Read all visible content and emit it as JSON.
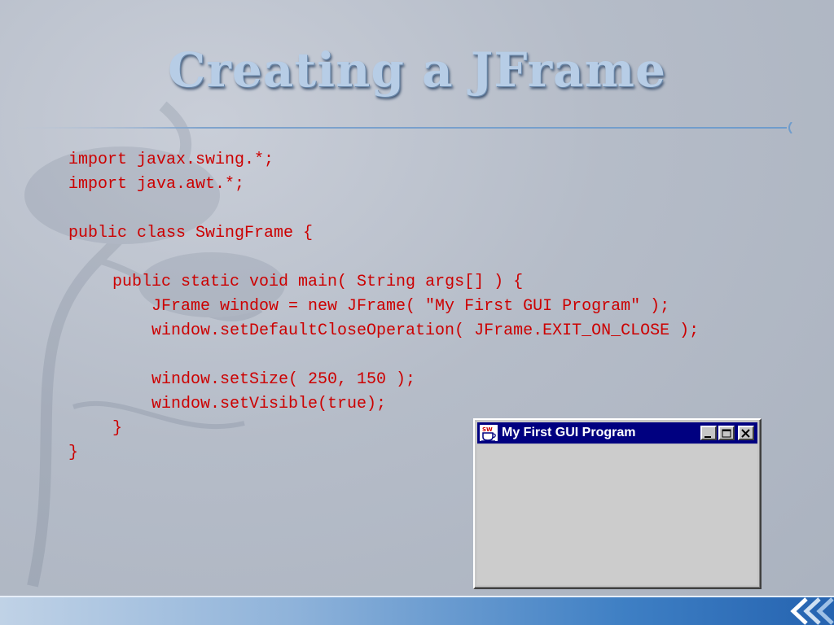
{
  "slide": {
    "title": "Creating a JFrame"
  },
  "code": {
    "lines": [
      "import javax.swing.*;",
      "import java.awt.*;",
      "",
      "public class SwingFrame {",
      "",
      "public static void main( String args[] ) {",
      "JFrame window = new JFrame( \"My First GUI Program\" );",
      "window.setDefaultCloseOperation( JFrame.EXIT_ON_CLOSE );",
      "",
      "window.setSize( 250, 150 );",
      "window.setVisible(true);",
      "}",
      "}"
    ],
    "color": "#cc0000"
  },
  "window": {
    "title": "My First GUI Program",
    "icon": "java-cup-icon",
    "controls": [
      "minimize-icon",
      "maximize-icon",
      "close-icon"
    ],
    "titlebar_color": "#000080"
  },
  "colors": {
    "title": "#b7cde6",
    "accent": "#2563b0"
  }
}
